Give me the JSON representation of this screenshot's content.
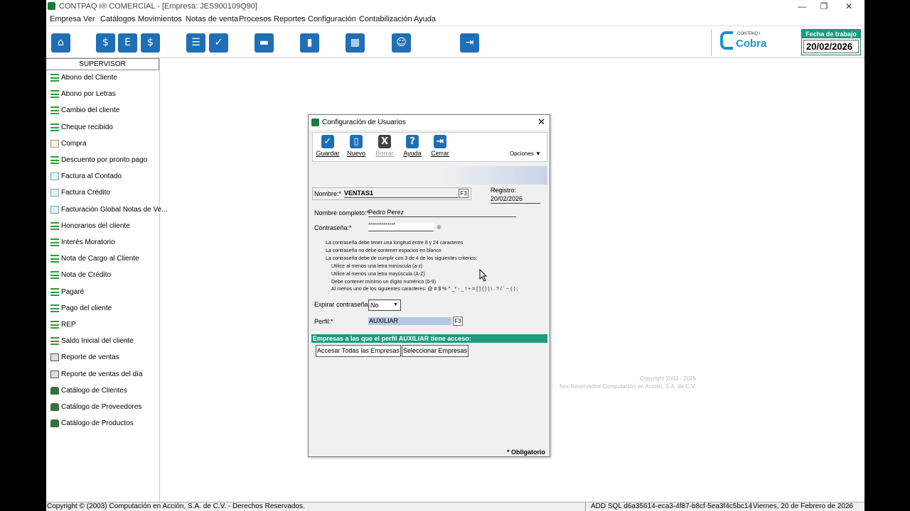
{
  "window": {
    "title": "CONTPAQ i® COMERCIAL - [Empresa: JES900109Q90]",
    "minimize": "—",
    "restore": "❐",
    "close": "✕"
  },
  "menu": [
    "Empresa",
    "Ver",
    "Catálogos",
    "Movimientos",
    "Notas de venta",
    "Procesos",
    "Reportes",
    "Configuración",
    "Contabilización",
    "Ayuda"
  ],
  "toolbar": {
    "icons": [
      "home-icon",
      "money-icon",
      "invoice-icon",
      "cash-icon",
      "list-icon",
      "checklist-icon",
      "truck-icon",
      "chart-icon",
      "table-icon",
      "user-icon",
      "exit-icon"
    ],
    "logo_small": "CONTPAQ i",
    "logo_big": "Cobra",
    "fecha_label": "Fecha de trabajo",
    "fecha_value": "20/02/2026"
  },
  "sidebar": {
    "header": "SUPERVISOR",
    "items": [
      {
        "label": "Abono del Cliente",
        "icon": "lines"
      },
      {
        "label": "Abono por Letras",
        "icon": "lines"
      },
      {
        "label": "Cambio del cliente",
        "icon": "lines"
      },
      {
        "label": "Cheque recibido",
        "icon": "lines"
      },
      {
        "label": "Compra",
        "icon": "doc"
      },
      {
        "label": "Descuento por pronto pago",
        "icon": "lines"
      },
      {
        "label": "Factura al Contado",
        "icon": "doc2"
      },
      {
        "label": "Factura Crédito",
        "icon": "doc2"
      },
      {
        "label": "Facturación Global Notas de Ve...",
        "icon": "doc2"
      },
      {
        "label": "Honorarios del cliente",
        "icon": "lines"
      },
      {
        "label": "Interés Moratorio",
        "icon": "lines"
      },
      {
        "label": "Nota de Cargo al Cliente",
        "icon": "lines"
      },
      {
        "label": "Nota de Crédito",
        "icon": "lines"
      },
      {
        "label": "Pagaré",
        "icon": "lines"
      },
      {
        "label": "Pago del cliente",
        "icon": "lines"
      },
      {
        "label": "REP",
        "icon": "lines"
      },
      {
        "label": "Saldo Inicial del cliente",
        "icon": "lines"
      },
      {
        "label": "Reporte de ventas",
        "icon": "rep"
      },
      {
        "label": "Reporte de ventas del día",
        "icon": "rep"
      },
      {
        "label": "Catálogo de Clientes",
        "icon": "ppl"
      },
      {
        "label": "Catálogo de Proveedores",
        "icon": "ppl"
      },
      {
        "label": "Catálogo de Productos",
        "icon": "ppl"
      }
    ]
  },
  "background": {
    "copyright_line1": "Copyright 2003 - 2025",
    "copyright_line2": "hos Reservados Computación en Acción, S.A. de C.V."
  },
  "status": {
    "left": "Copyright © (2003) Computación en Acción, S.A. de C.V. - Derechos Reservados.",
    "mid": "ADD  SQL  d6a35614-eca3-4f87-b8cf-5ea3f4c5bc14",
    "right": "Viernes, 20 de Febrero de 2026"
  },
  "dialog": {
    "title": "Configuración de Usuarios",
    "close": "✕",
    "buttons": [
      {
        "label": "Guardar",
        "glyph": "✓",
        "color": "#1f6fb5",
        "enabled": true
      },
      {
        "label": "Nuevo",
        "glyph": "▯",
        "color": "#1f6fb5",
        "enabled": true
      },
      {
        "label": "Borrar",
        "glyph": "X",
        "color": "#444444",
        "enabled": false
      },
      {
        "label": "Ayuda",
        "glyph": "?",
        "color": "#1f6fb5",
        "enabled": true
      },
      {
        "label": "Cerrar",
        "glyph": "⇥",
        "color": "#1f6fb5",
        "enabled": true
      }
    ],
    "opciones": "Opciones ▼",
    "nombre_label": "Nombre:*",
    "nombre_value": "VENTAS1",
    "f3": "F3",
    "registro_label": "Registro:",
    "registro_value": "20/02/2026",
    "nombre_completo_label": "Nombre completo:*",
    "nombre_completo_value": "Pedro Perez",
    "contrasena_label": "Contraseña:*",
    "contrasena_value": "**************",
    "rules": [
      "La contraseña debe tener una longitud entre 8 y 24 caracteres",
      "La contraseña no debe contener espacios en blanco",
      "La contraseña debe de cumplir con 3 de 4 de los siguientes criterios:",
      "Utilice al menos una letra minúscula (a-z)",
      "Utilice al menos una letra mayúscula (A-Z)",
      "Debe contener mínimo un dígito numérico (0-9)",
      "Al menos uno de los siguientes caracteres: @ # $ % ^ _* - _ ! + = [ ] { } | \\ . ? / ` ~ ( ) ;"
    ],
    "expirar_label": "Expirar contraseña:",
    "expirar_value": "No",
    "perfil_label": "Perfil:*",
    "perfil_value": "AUXILIAR",
    "empresas_bar": "Empresas a las que el perfil AUXILIAR tiene acceso:",
    "btn_todas": "Accesar Todas las Empresas",
    "btn_seleccionar": "Seleccionar Empresas",
    "obligatorio": "* Obligatorio"
  }
}
